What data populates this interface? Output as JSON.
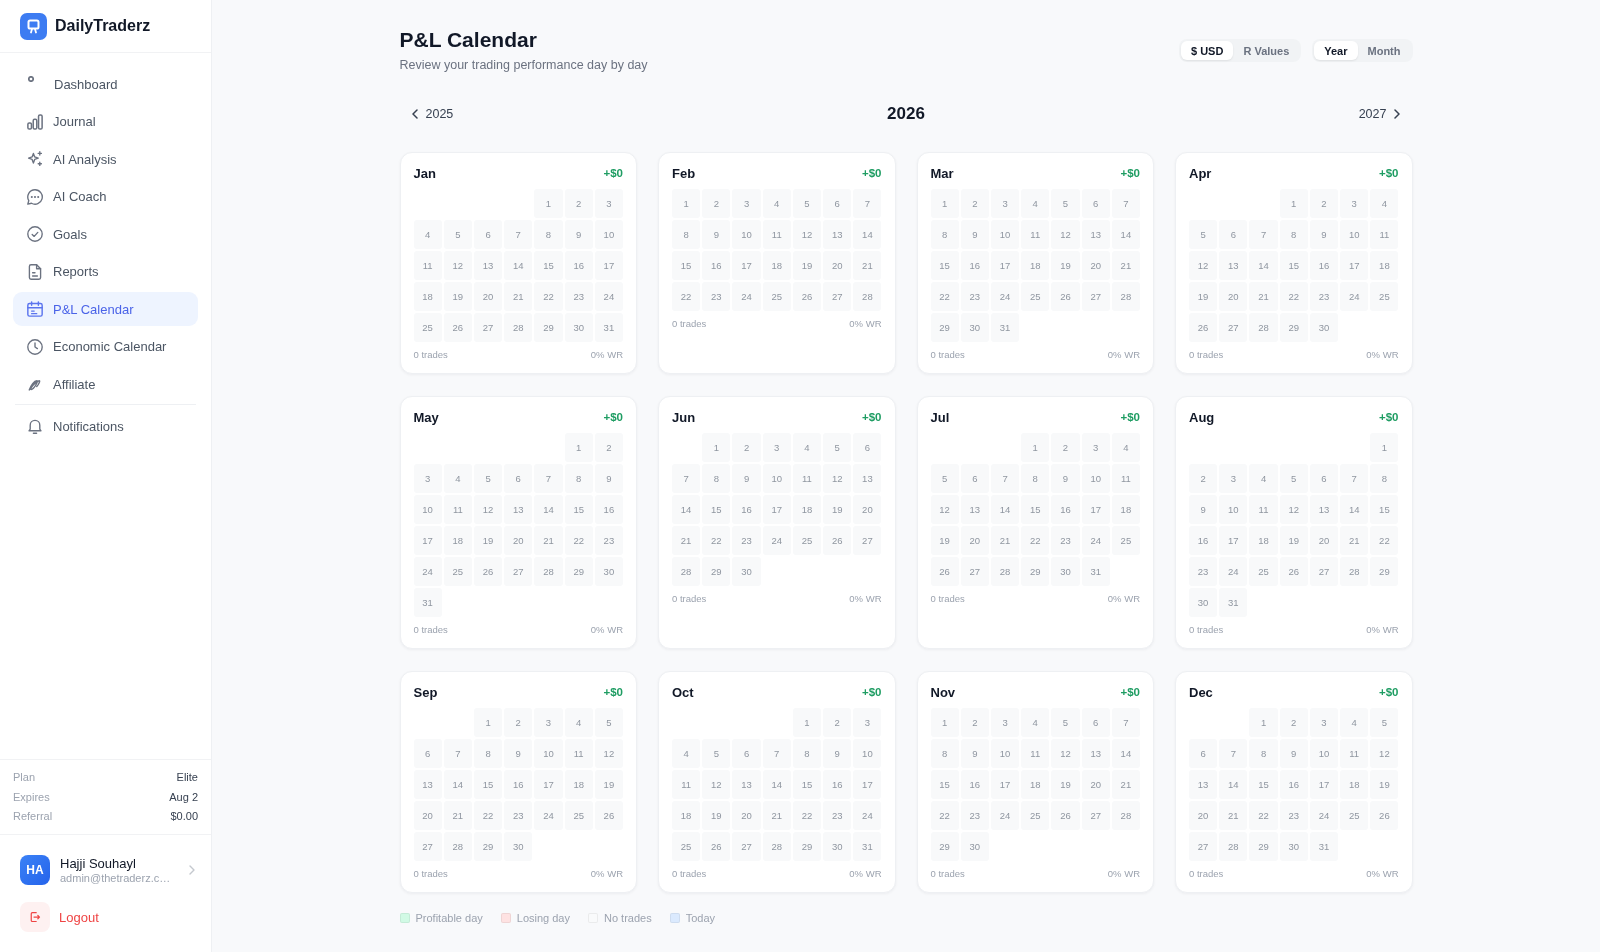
{
  "sidebar": {
    "brand": "DailyTraderz",
    "nav": [
      {
        "label": "Dashboard",
        "selected": false
      },
      {
        "label": "Journal",
        "selected": false
      },
      {
        "label": "AI Analysis",
        "selected": false
      },
      {
        "label": "AI Coach",
        "selected": false
      },
      {
        "label": "Goals",
        "selected": false
      },
      {
        "label": "Reports",
        "selected": false
      },
      {
        "label": "P&L Calendar",
        "selected": true
      },
      {
        "label": "Economic Calendar",
        "selected": false
      },
      {
        "label": "Affiliate",
        "selected": false
      }
    ],
    "nav_footer": [
      {
        "label": "Notifications",
        "selected": false
      }
    ],
    "plan": [
      {
        "label": "Plan",
        "value": "Elite"
      },
      {
        "label": "Expires",
        "value": "Aug 2"
      },
      {
        "label": "Referral",
        "value": "$0.00"
      }
    ],
    "user": {
      "initials": "HA",
      "name": "Hajji Souhayl",
      "email": "admin@thetraderz.c…"
    },
    "logout": "Logout"
  },
  "header": {
    "title": "P&L Calendar",
    "subtitle": "Review your trading performance day by day",
    "unit_toggle": [
      {
        "label": "$ USD",
        "selected": true
      },
      {
        "label": "R Values",
        "selected": false
      }
    ],
    "view_toggle": [
      {
        "label": "Year",
        "selected": true
      },
      {
        "label": "Month",
        "selected": false
      }
    ]
  },
  "year_nav": {
    "prev": "2025",
    "current": "2026",
    "next": "2027"
  },
  "months": [
    {
      "name": "Jan",
      "pnl": "+$0",
      "positive": true,
      "weeks": [
        [
          "1",
          "2",
          "3"
        ],
        [
          "4",
          "5",
          "6",
          "7",
          "8",
          "9",
          "10"
        ],
        [
          "11",
          "12",
          "13",
          "14",
          "15",
          "16",
          "17"
        ],
        [
          "18",
          "19",
          "20",
          "21",
          "22",
          "23",
          "24"
        ],
        [
          "25",
          "26",
          "27",
          "28",
          "29",
          "30",
          "31"
        ]
      ],
      "trades": "0 trades",
      "win_rate": "0% WR"
    },
    {
      "name": "Feb",
      "pnl": "+$0",
      "positive": true,
      "weeks": [
        [
          "1",
          "2",
          "3",
          "4",
          "5",
          "6",
          "7"
        ],
        [
          "8",
          "9",
          "10",
          "11",
          "12",
          "13",
          "14"
        ],
        [
          "15",
          "16",
          "17",
          "18",
          "19",
          "20",
          "21"
        ],
        [
          "22",
          "23",
          "24",
          "25",
          "26",
          "27",
          "28"
        ]
      ],
      "trades": "0 trades",
      "win_rate": "0% WR"
    },
    {
      "name": "Mar",
      "pnl": "+$0",
      "positive": true,
      "weeks": [
        [
          "1",
          "2",
          "3",
          "4",
          "5",
          "6",
          "7"
        ],
        [
          "8",
          "9",
          "10",
          "11",
          "12",
          "13",
          "14"
        ],
        [
          "15",
          "16",
          "17",
          "18",
          "19",
          "20",
          "21"
        ],
        [
          "22",
          "23",
          "24",
          "25",
          "26",
          "27",
          "28"
        ],
        [
          "29",
          "30",
          "31"
        ]
      ],
      "trades": "0 trades",
      "win_rate": "0% WR"
    },
    {
      "name": "Apr",
      "pnl": "+$0",
      "positive": true,
      "weeks": [
        [
          "1",
          "2",
          "3",
          "4"
        ],
        [
          "5",
          "6",
          "7",
          "8",
          "9",
          "10",
          "11"
        ],
        [
          "12",
          "13",
          "14",
          "15",
          "16",
          "17",
          "18"
        ],
        [
          "19",
          "20",
          "21",
          "22",
          "23",
          "24",
          "25"
        ],
        [
          "26",
          "27",
          "28",
          "29",
          "30"
        ]
      ],
      "trades": "0 trades",
      "win_rate": "0% WR"
    },
    {
      "name": "May",
      "pnl": "+$0",
      "positive": true,
      "weeks": [
        [
          "1",
          "2"
        ],
        [
          "3",
          "4",
          "5",
          "6",
          "7",
          "8",
          "9"
        ],
        [
          "10",
          "11",
          "12",
          "13",
          "14",
          "15",
          "16"
        ],
        [
          "17",
          "18",
          "19",
          "20",
          "21",
          "22",
          "23"
        ],
        [
          "24",
          "25",
          "26",
          "27",
          "28",
          "29",
          "30"
        ],
        [
          "31"
        ]
      ],
      "trades": "0 trades",
      "win_rate": "0% WR"
    },
    {
      "name": "Jun",
      "pnl": "+$0",
      "positive": true,
      "weeks": [
        [
          "1",
          "2",
          "3",
          "4",
          "5",
          "6"
        ],
        [
          "7",
          "8",
          "9",
          "10",
          "11",
          "12",
          "13"
        ],
        [
          "14",
          "15",
          "16",
          "17",
          "18",
          "19",
          "20"
        ],
        [
          "21",
          "22",
          "23",
          "24",
          "25",
          "26",
          "27"
        ],
        [
          "28",
          "29",
          "30"
        ]
      ],
      "trades": "0 trades",
      "win_rate": "0% WR"
    },
    {
      "name": "Jul",
      "pnl": "+$0",
      "positive": true,
      "weeks": [
        [
          "1",
          "2",
          "3",
          "4"
        ],
        [
          "5",
          "6",
          "7",
          "8",
          "9",
          "10",
          "11"
        ],
        [
          "12",
          "13",
          "14",
          "15",
          "16",
          "17",
          "18"
        ],
        [
          "19",
          "20",
          "21",
          "22",
          "23",
          "24",
          "25"
        ],
        [
          "26",
          "27",
          "28",
          "29",
          "30",
          "31"
        ]
      ],
      "trades": "0 trades",
      "win_rate": "0% WR"
    },
    {
      "name": "Aug",
      "pnl": "+$0",
      "positive": true,
      "weeks": [
        [
          "1"
        ],
        [
          "2",
          "3",
          "4",
          "5",
          "6",
          "7",
          "8"
        ],
        [
          "9",
          "10",
          "11",
          "12",
          "13",
          "14",
          "15"
        ],
        [
          "16",
          "17",
          "18",
          "19",
          "20",
          "21",
          "22"
        ],
        [
          "23",
          "24",
          "25",
          "26",
          "27",
          "28",
          "29"
        ],
        [
          "30",
          "31"
        ]
      ],
      "trades": "0 trades",
      "win_rate": "0% WR"
    },
    {
      "name": "Sep",
      "pnl": "+$0",
      "positive": true,
      "weeks": [
        [
          "1",
          "2",
          "3",
          "4",
          "5"
        ],
        [
          "6",
          "7",
          "8",
          "9",
          "10",
          "11",
          "12"
        ],
        [
          "13",
          "14",
          "15",
          "16",
          "17",
          "18",
          "19"
        ],
        [
          "20",
          "21",
          "22",
          "23",
          "24",
          "25",
          "26"
        ],
        [
          "27",
          "28",
          "29",
          "30"
        ]
      ],
      "trades": "0 trades",
      "win_rate": "0% WR"
    },
    {
      "name": "Oct",
      "pnl": "+$0",
      "positive": true,
      "weeks": [
        [
          "1",
          "2",
          "3"
        ],
        [
          "4",
          "5",
          "6",
          "7",
          "8",
          "9",
          "10"
        ],
        [
          "11",
          "12",
          "13",
          "14",
          "15",
          "16",
          "17"
        ],
        [
          "18",
          "19",
          "20",
          "21",
          "22",
          "23",
          "24"
        ],
        [
          "25",
          "26",
          "27",
          "28",
          "29",
          "30",
          "31"
        ]
      ],
      "trades": "0 trades",
      "win_rate": "0% WR"
    },
    {
      "name": "Nov",
      "pnl": "+$0",
      "positive": true,
      "weeks": [
        [
          "1",
          "2",
          "3",
          "4",
          "5",
          "6",
          "7"
        ],
        [
          "8",
          "9",
          "10",
          "11",
          "12",
          "13",
          "14"
        ],
        [
          "15",
          "16",
          "17",
          "18",
          "19",
          "20",
          "21"
        ],
        [
          "22",
          "23",
          "24",
          "25",
          "26",
          "27",
          "28"
        ],
        [
          "29",
          "30"
        ]
      ],
      "trades": "0 trades",
      "win_rate": "0% WR"
    },
    {
      "name": "Dec",
      "pnl": "+$0",
      "positive": true,
      "weeks": [
        [
          "1",
          "2",
          "3",
          "4",
          "5"
        ],
        [
          "6",
          "7",
          "8",
          "9",
          "10",
          "11",
          "12"
        ],
        [
          "13",
          "14",
          "15",
          "16",
          "17",
          "18",
          "19"
        ],
        [
          "20",
          "21",
          "22",
          "23",
          "24",
          "25",
          "26"
        ],
        [
          "27",
          "28",
          "29",
          "30",
          "31"
        ]
      ],
      "trades": "0 trades",
      "win_rate": "0% WR"
    }
  ],
  "legend": [
    {
      "label": "Profitable day",
      "color": "#d1fae5"
    },
    {
      "label": "Losing day",
      "color": "#fee2e2"
    },
    {
      "label": "No trades",
      "color": "#f9fafb"
    },
    {
      "label": "Today",
      "color": "#dbeafe"
    }
  ]
}
